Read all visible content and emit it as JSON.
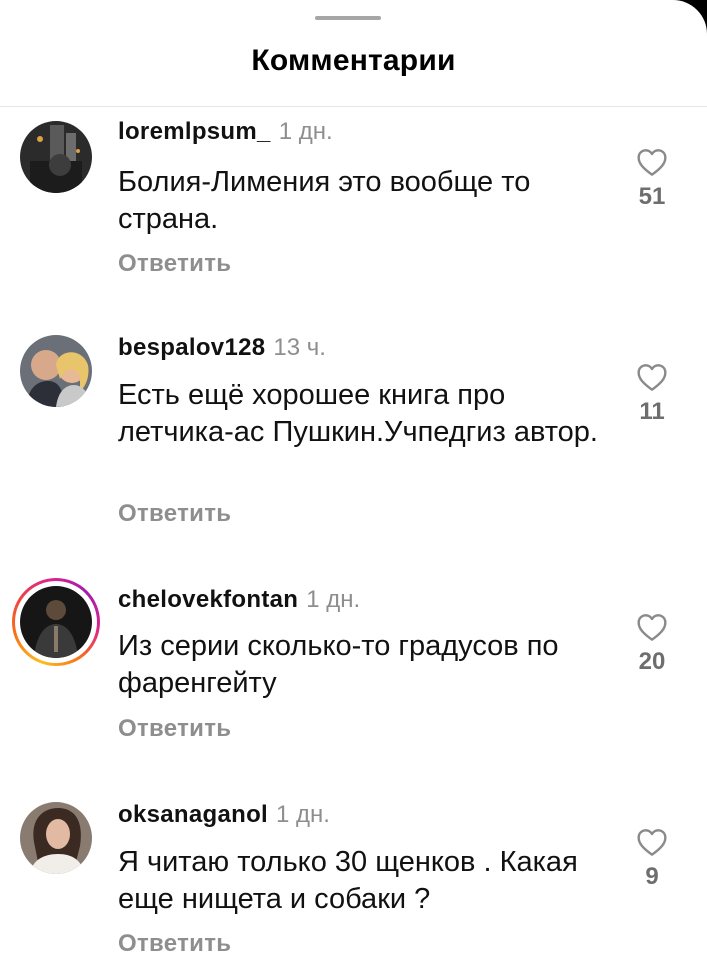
{
  "sheet": {
    "title": "Комментарии"
  },
  "comments": [
    {
      "username": "loremlpsum_",
      "time": "1 дн.",
      "text": "Болия-Лимения это вообще то страна.",
      "reply_label": "Ответить",
      "likes": "51",
      "avatar_icon": "avatar-photo",
      "has_story": false
    },
    {
      "username": "bespalov128",
      "time": "13 ч.",
      "text": "Есть ещё хорошее книга про летчика-ас Пушкин.Учпедгиз автор.",
      "reply_label": "Ответить",
      "likes": "11",
      "avatar_icon": "avatar-photo",
      "has_story": false
    },
    {
      "username": "chelovekfontan",
      "time": "1 дн.",
      "text": "Из серии сколько-то градусов по фаренгейту",
      "reply_label": "Ответить",
      "likes": "20",
      "avatar_icon": "avatar-photo",
      "has_story": true
    },
    {
      "username": "oksanaganol",
      "time": "1 дн.",
      "text": "Я читаю только 30 щенков . Какая еще нищета и собаки ?",
      "reply_label": "Ответить",
      "likes": "9",
      "avatar_icon": "avatar-photo",
      "has_story": false
    }
  ],
  "icons": {
    "like": "heart-outline-icon"
  },
  "colors": {
    "secondary_text": "#8e8e8e",
    "story_ring": "#d8238c"
  }
}
